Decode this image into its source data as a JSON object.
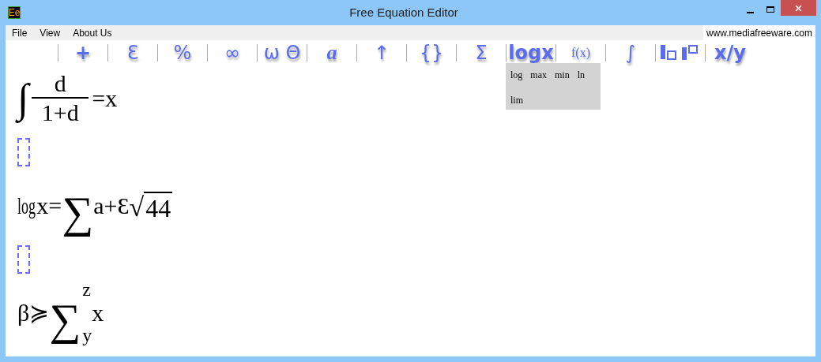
{
  "window": {
    "icon_text": "Ee",
    "title": "Free Equation Editor"
  },
  "menu": [
    "File",
    "View",
    "About Us"
  ],
  "website": "www.mediafreeware.com",
  "toolbar": [
    {
      "kind": "bold",
      "label": "+"
    },
    {
      "kind": "plain",
      "label": "Ɛ"
    },
    {
      "kind": "plain",
      "label": "%"
    },
    {
      "kind": "plain",
      "label": "∞"
    },
    {
      "kind": "plain",
      "label": "ω Θ"
    },
    {
      "kind": "italic",
      "label": "a"
    },
    {
      "kind": "plain",
      "label": "↑"
    },
    {
      "kind": "plain",
      "label": "{}"
    },
    {
      "kind": "plain",
      "label": "Σ"
    },
    {
      "kind": "bold",
      "label": "logx"
    },
    {
      "kind": "small",
      "label": "f(x)"
    },
    {
      "kind": "plain",
      "label": "∫"
    },
    {
      "kind": "boxes"
    },
    {
      "kind": "bold",
      "label": "x/y"
    }
  ],
  "dropdown": [
    "log",
    "max",
    "min",
    "ln",
    "lim"
  ],
  "rows": [
    {
      "kind": "equation",
      "parts": [
        {
          "kind": "integral",
          "symbol": "∫"
        },
        {
          "kind": "fraction",
          "numerator": "d",
          "denominator": "1+d"
        },
        {
          "kind": "text",
          "text": "=x"
        }
      ]
    },
    {
      "kind": "placeholder"
    },
    {
      "kind": "equation",
      "parts": [
        {
          "kind": "condensed",
          "text": "log"
        },
        {
          "kind": "text",
          "text": "x="
        },
        {
          "kind": "sum",
          "symbol": "∑"
        },
        {
          "kind": "text",
          "text": "a+Ɛ"
        },
        {
          "kind": "root",
          "sign": "√",
          "radicand": "44"
        }
      ]
    },
    {
      "kind": "placeholder"
    },
    {
      "kind": "equation",
      "parts": [
        {
          "kind": "text",
          "text": "β≽"
        },
        {
          "kind": "sum",
          "symbol": "∑",
          "upper": "z",
          "lower": "y"
        },
        {
          "kind": "text",
          "text": "x"
        }
      ]
    }
  ]
}
